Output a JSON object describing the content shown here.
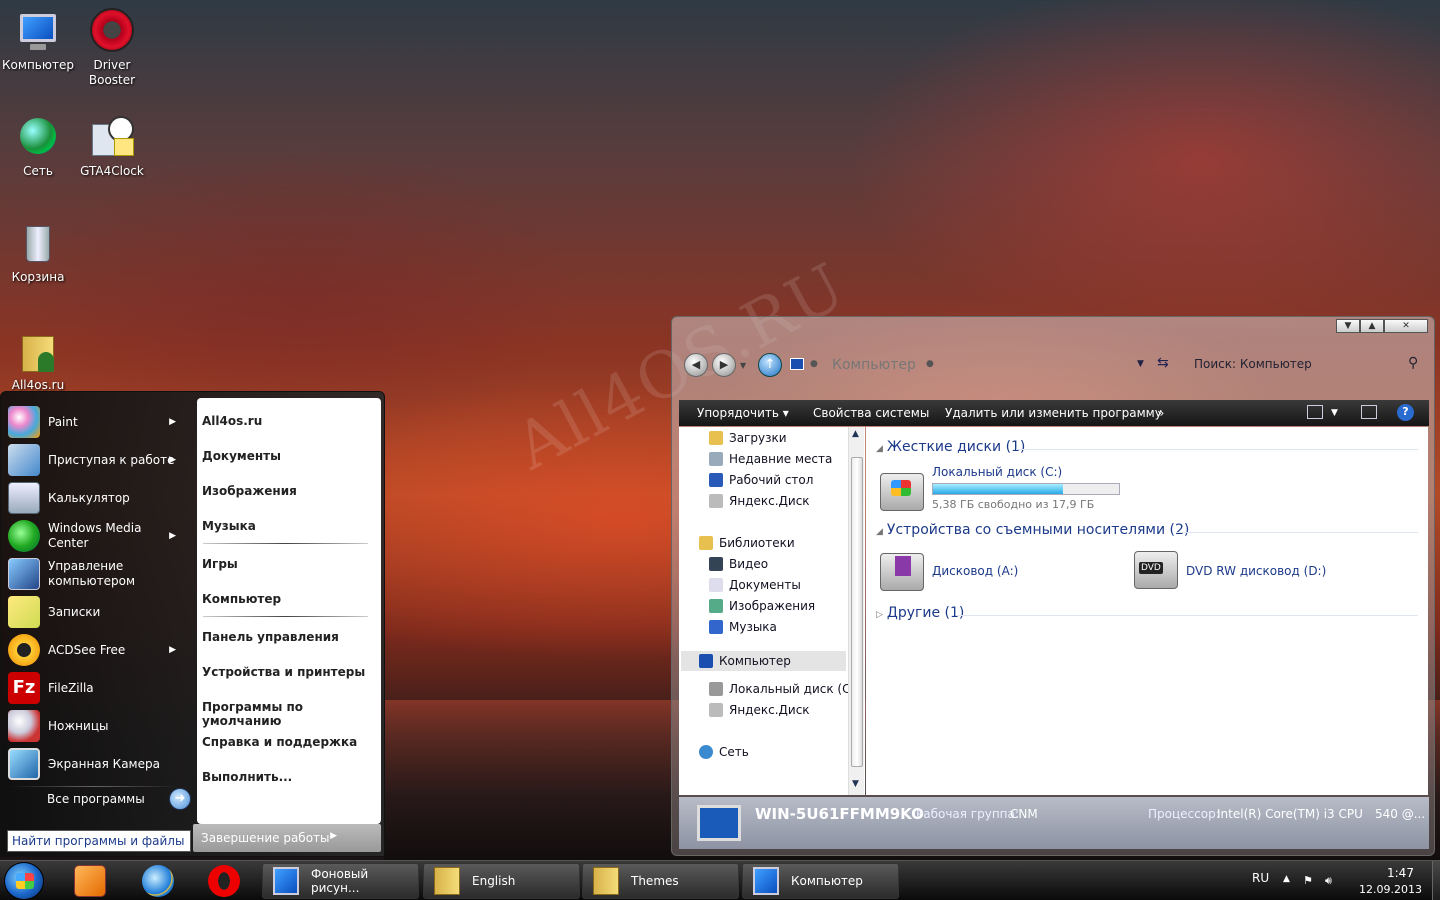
{
  "desktop": {
    "watermark": "All4OS.RU",
    "icons": [
      {
        "label": "Компьютер",
        "icon": "computer-icon"
      },
      {
        "label": "Driver Booster",
        "icon": "driver-booster-icon"
      },
      {
        "label": "Сеть",
        "icon": "network-icon"
      },
      {
        "label": "GTA4Clock",
        "icon": "clock-gadget-icon"
      },
      {
        "label": "Корзина",
        "icon": "recycle-bin-icon"
      },
      {
        "label": "All4os.ru",
        "icon": "folder-user-icon"
      }
    ]
  },
  "start_menu": {
    "programs": [
      {
        "label": "Paint",
        "has_submenu": true
      },
      {
        "label": "Приступая к работе",
        "has_submenu": true
      },
      {
        "label": "Калькулятор",
        "has_submenu": false
      },
      {
        "label": "Windows Media Center",
        "has_submenu": true
      },
      {
        "label": "Управление компьютером",
        "has_submenu": false
      },
      {
        "label": "Записки",
        "has_submenu": false
      },
      {
        "label": "ACDSee Free",
        "has_submenu": true
      },
      {
        "label": "FileZilla",
        "has_submenu": false
      },
      {
        "label": "Ножницы",
        "has_submenu": false
      },
      {
        "label": "Экранная Камера",
        "has_submenu": false
      }
    ],
    "all_programs": "Все программы",
    "search_placeholder": "Найти программы и файлы",
    "places": [
      "All4os.ru",
      "Документы",
      "Изображения",
      "Музыка",
      "Игры",
      "Компьютер",
      "Панель управления",
      "Устройства и принтеры",
      "Программы по умолчанию",
      "Справка и поддержка",
      "Выполнить..."
    ],
    "shutdown": "Завершение работы"
  },
  "explorer": {
    "address": "Компьютер",
    "search_placeholder": "Поиск: Компьютер",
    "toolbar": {
      "organize": "Упорядочить",
      "system_props": "Свойства системы",
      "uninstall": "Удалить или изменить программу",
      "more": "»"
    },
    "nav": {
      "favorites": [
        "Загрузки",
        "Недавние места",
        "Рабочий стол",
        "Яндекс.Диск"
      ],
      "libraries_title": "Библиотеки",
      "libraries": [
        "Видео",
        "Документы",
        "Изображения",
        "Музыка"
      ],
      "computer_title": "Компьютер",
      "computer": [
        "Локальный диск (C:)",
        "Яндекс.Диск"
      ],
      "network": "Сеть"
    },
    "content": {
      "hdd_group": "Жесткие диски (1)",
      "local_disk_name": "Локальный диск (C:)",
      "local_disk_free": "5,38 ГБ свободно из 17,9 ГБ",
      "local_disk_used_fraction": 0.7,
      "removable_group": "Устройства со съемными носителями (2)",
      "floppy": "Дисковод (A:)",
      "dvd": "DVD RW дисковод (D:)",
      "dvd_badge": "DVD",
      "other_group": "Другие (1)"
    },
    "details": {
      "pc_name": "WIN-5U61FFMM9KO",
      "workgroup_label": "Рабочая группа:",
      "workgroup": "CNM",
      "cpu_label": "Процессор:",
      "cpu": "Intel(R) Core(TM) i3 CPU",
      "more": "540 @..."
    }
  },
  "taskbar": {
    "buttons": [
      {
        "label": "Фоновый рисун...",
        "icon": "display-settings-icon"
      },
      {
        "label": "English",
        "icon": "folder-icon"
      },
      {
        "label": "Themes",
        "icon": "folder-icon"
      },
      {
        "label": "Компьютер",
        "icon": "computer-icon"
      }
    ],
    "lang": "RU",
    "time": "1:47",
    "date": "12.09.2013"
  },
  "colors": {
    "accent": "#1c3a8a",
    "progress": "#28a8e8"
  }
}
